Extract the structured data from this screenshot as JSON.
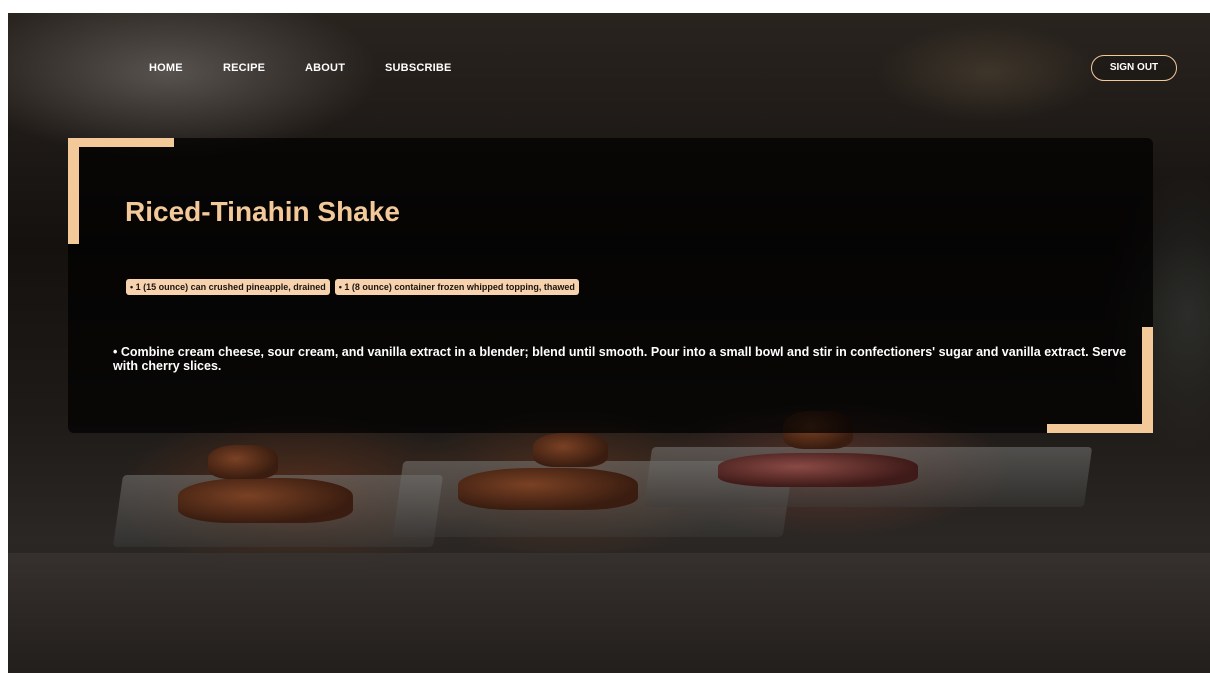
{
  "nav": {
    "links": [
      "HOME",
      "RECIPE",
      "ABOUT",
      "SUBSCRIBE"
    ],
    "signout_label": "SIGN OUT"
  },
  "recipe": {
    "title": "Riced-Tinahin Shake",
    "ingredients": [
      "• 1 (15 ounce) can crushed pineapple, drained",
      "• 1 (8 ounce) container frozen whipped topping, thawed"
    ],
    "instructions": "• Combine cream cheese, sour cream, and vanilla extract in a blender; blend until smooth. Pour into a small bowl and stir in confectioners' sugar and vanilla extract. Serve with cherry slices."
  },
  "colors": {
    "accent": "#f4c99a",
    "chip_bg": "#f6d3ae",
    "card_bg": "rgba(0,0,0,0.72)"
  }
}
